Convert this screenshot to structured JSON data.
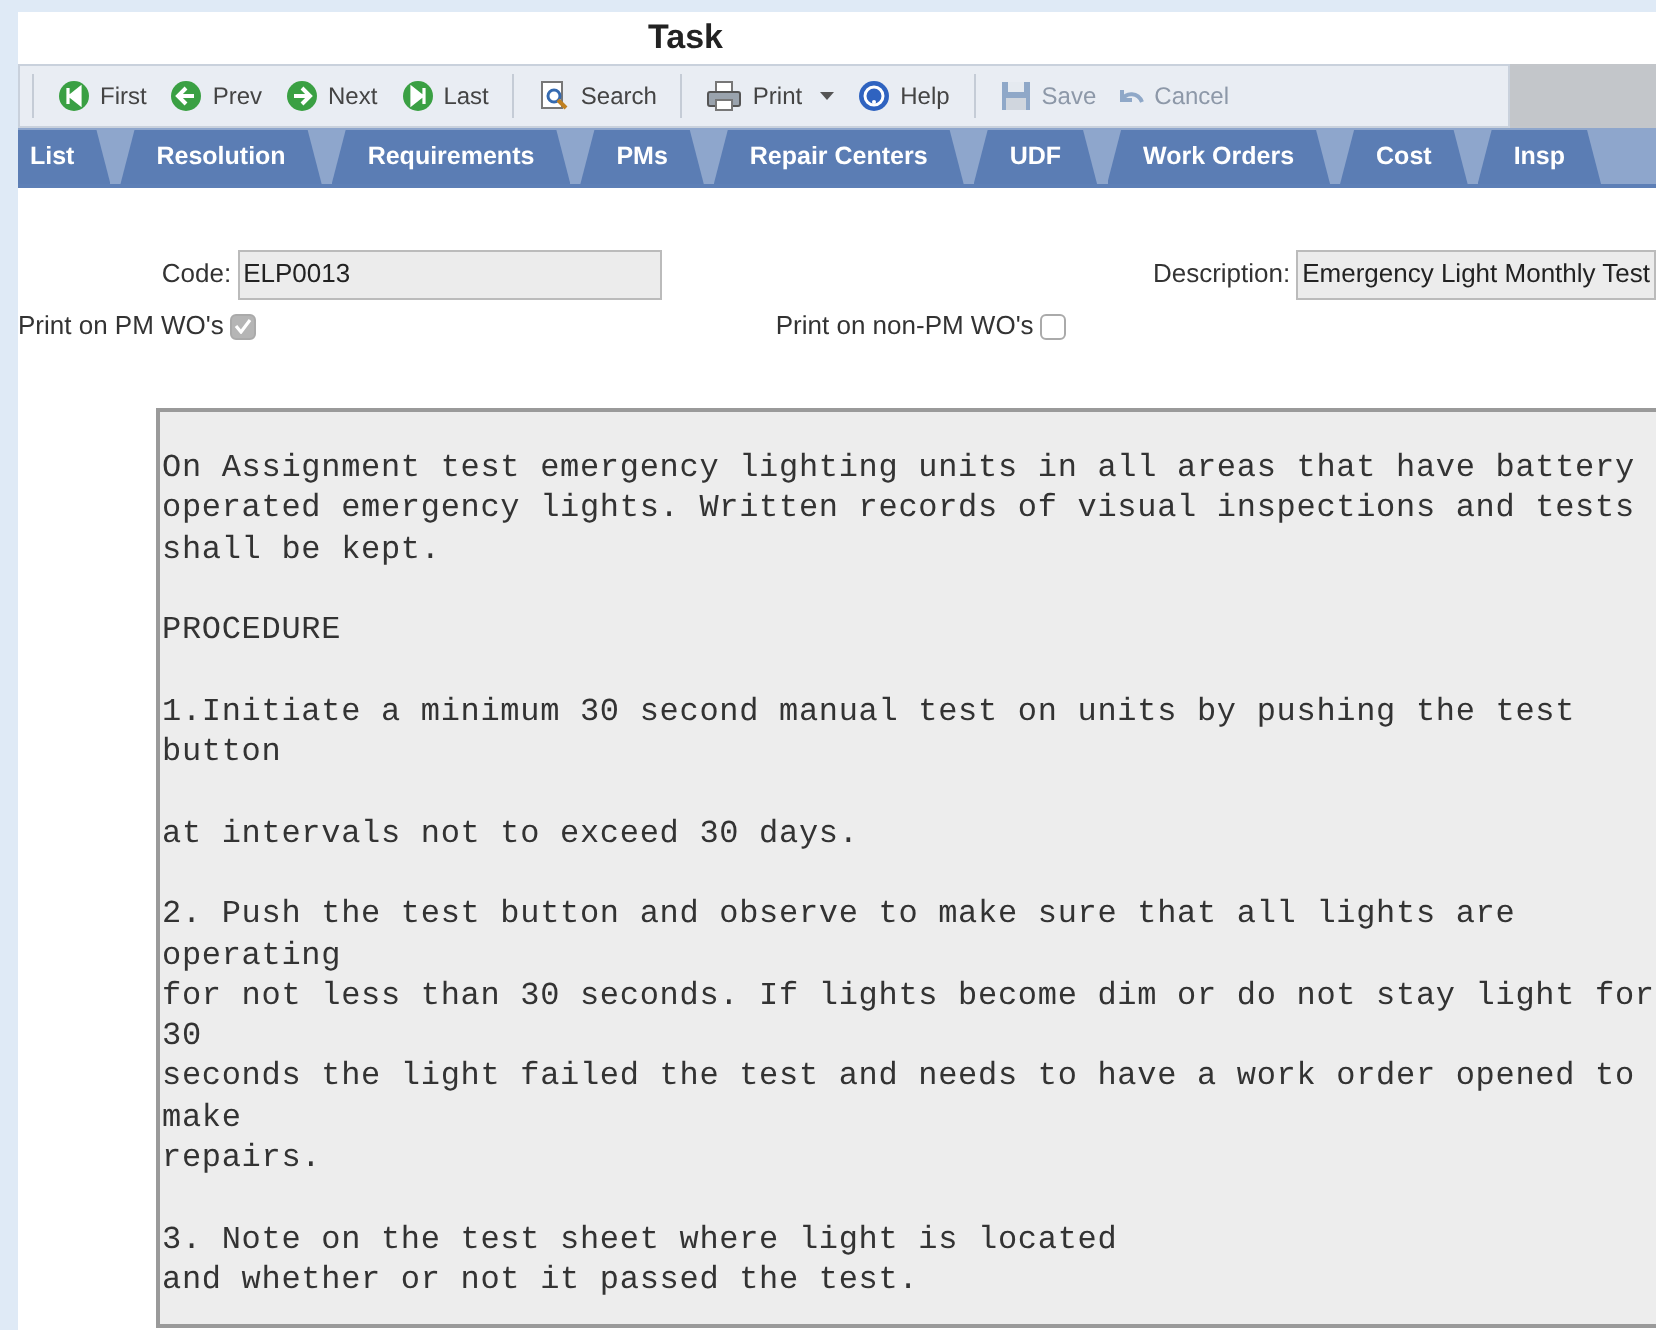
{
  "window": {
    "title": "Task"
  },
  "toolbar": [
    [
      {
        "label": "First",
        "kind": "first",
        "disabled": false
      },
      {
        "label": "Prev",
        "kind": "prev",
        "disabled": false
      },
      {
        "label": "Next",
        "kind": "next",
        "disabled": false
      },
      {
        "label": "Last",
        "kind": "last",
        "disabled": false
      }
    ],
    [
      {
        "label": "Search",
        "kind": "search",
        "disabled": false
      }
    ],
    [
      {
        "label": "Print",
        "kind": "print",
        "disabled": false,
        "dropdown": true
      },
      {
        "label": "Help",
        "kind": "help",
        "disabled": false
      }
    ],
    [
      {
        "label": "Save",
        "kind": "save",
        "disabled": true
      },
      {
        "label": "Cancel",
        "kind": "cancel",
        "disabled": true
      }
    ]
  ],
  "tabs": [
    {
      "label": "List",
      "selected": false
    },
    {
      "label": "Resolution",
      "selected": false
    },
    {
      "label": "Requirements",
      "selected": false
    },
    {
      "label": "PMs",
      "selected": false
    },
    {
      "label": "Repair Centers",
      "selected": false
    },
    {
      "label": "UDF",
      "selected": false
    },
    {
      "label": "Work Orders",
      "selected": false
    },
    {
      "label": "Cost",
      "selected": false
    },
    {
      "label": "Insp",
      "selected": false
    }
  ],
  "form": {
    "code": {
      "label": "Code:",
      "value": "ELP0013"
    },
    "description": {
      "label": "Description:",
      "value": "Emergency Light Monthly Test"
    },
    "print_on_pm": {
      "label": "Print on PM WO's",
      "checked": true
    },
    "print_on_non_pm": {
      "label": "Print on non-PM WO's",
      "checked": false
    },
    "notes": "On Assignment test emergency lighting units in all areas that have battery\noperated emergency lights. Written records of visual inspections and tests\nshall be kept.\n\nPROCEDURE\n\n1.Initiate a minimum 30 second manual test on units by pushing the test\nbutton\n\nat intervals not to exceed 30 days.\n\n2. Push the test button and observe to make sure that all lights are\noperating\nfor not less than 30 seconds. If lights become dim or do not stay light for\n30\nseconds the light failed the test and needs to have a work order opened to\nmake\nrepairs.\n\n3. Note on the test sheet where light is located\nand whether or not it passed the test."
  }
}
